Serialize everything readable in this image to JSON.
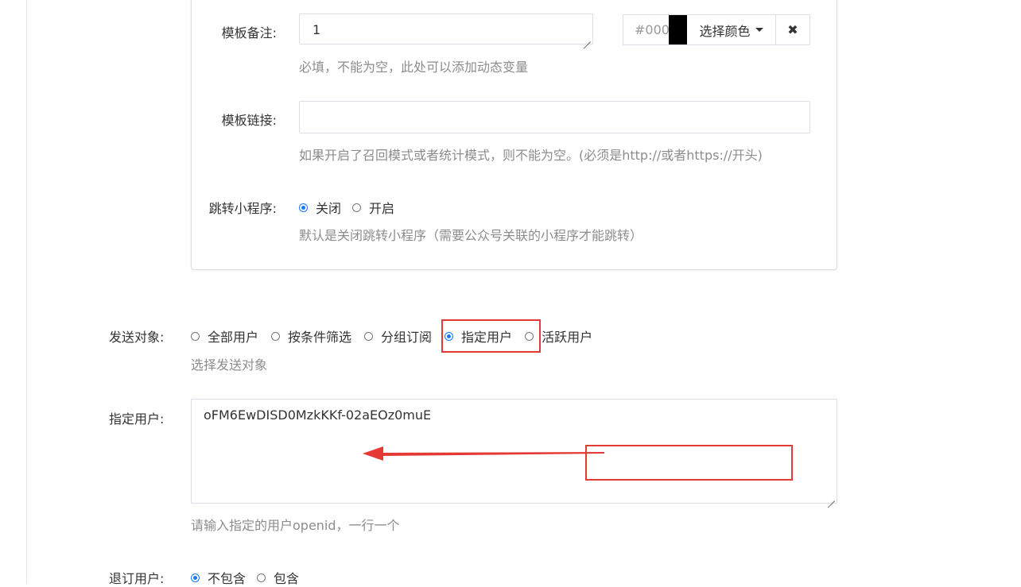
{
  "template": {
    "remark_label": "模板备注:",
    "remark_value": "1",
    "remark_help": "必填，不能为空，此处可以添加动态变量",
    "color": {
      "hex_value": "#000000",
      "swatch_color": "#000000",
      "choose_label": "选择颜色",
      "clear_icon": "✖"
    },
    "link_label": "模板链接:",
    "link_value": "",
    "link_help": "如果开启了召回模式或者统计模式，则不能为空。(必须是http://或者https://开头)",
    "miniprogram_label": "跳转小程序:",
    "miniprogram_options": [
      "关闭",
      "开启"
    ],
    "miniprogram_selected": "关闭",
    "miniprogram_help": "默认是关闭跳转小程序（需要公众号关联的小程序才能跳转）"
  },
  "send_target": {
    "label": "发送对象:",
    "options": [
      "全部用户",
      "按条件筛选",
      "分组订阅",
      "指定用户",
      "活跃用户"
    ],
    "selected": "指定用户",
    "help": "选择发送对象"
  },
  "specified_users": {
    "label": "指定用户:",
    "value": "oFM6EwDISD0MzkKKf-02aEOz0muE",
    "help": "请输入指定的用户openid，一行一个"
  },
  "unsubscribed": {
    "label": "退订用户:",
    "options": [
      "不包含",
      "包含"
    ],
    "selected": "不包含"
  },
  "annotation_color": "#e53935",
  "accent_color": "#1677ff"
}
